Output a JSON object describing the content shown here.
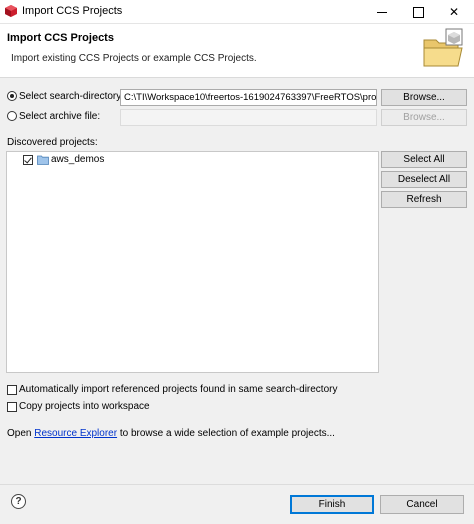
{
  "window": {
    "title": "Import CCS Projects"
  },
  "header": {
    "title": "Import CCS Projects",
    "description": "Import existing CCS Projects or example CCS Projects."
  },
  "source": {
    "search_dir_label": "Select search-directory:",
    "search_dir_value": "C:\\TI\\Workspace10\\freertos-1619024763397\\FreeRTOS\\projec",
    "archive_label": "Select archive file:",
    "archive_value": "",
    "browse_label": "Browse...",
    "selected": "search-directory"
  },
  "projects": {
    "label": "Discovered projects:",
    "items": [
      {
        "name": "aws_demos",
        "checked": true
      }
    ],
    "select_all_label": "Select All",
    "deselect_all_label": "Deselect All",
    "refresh_label": "Refresh"
  },
  "options": {
    "auto_import_label": "Automatically import referenced projects found in same search-directory",
    "auto_import_checked": false,
    "copy_label": "Copy projects into workspace",
    "copy_checked": false
  },
  "explorer": {
    "prefix": "Open ",
    "link": "Resource Explorer",
    "suffix": " to browse a wide selection of example projects..."
  },
  "footer": {
    "help_glyph": "?",
    "finish_label": "Finish",
    "cancel_label": "Cancel"
  },
  "icons": {
    "app": "ccs-cube-icon",
    "header": "folder-import-icon",
    "tree_item": "project-folder-icon"
  },
  "colors": {
    "accent": "#0078d7",
    "link": "#0033cc",
    "app_icon": "#cc1f2e"
  }
}
